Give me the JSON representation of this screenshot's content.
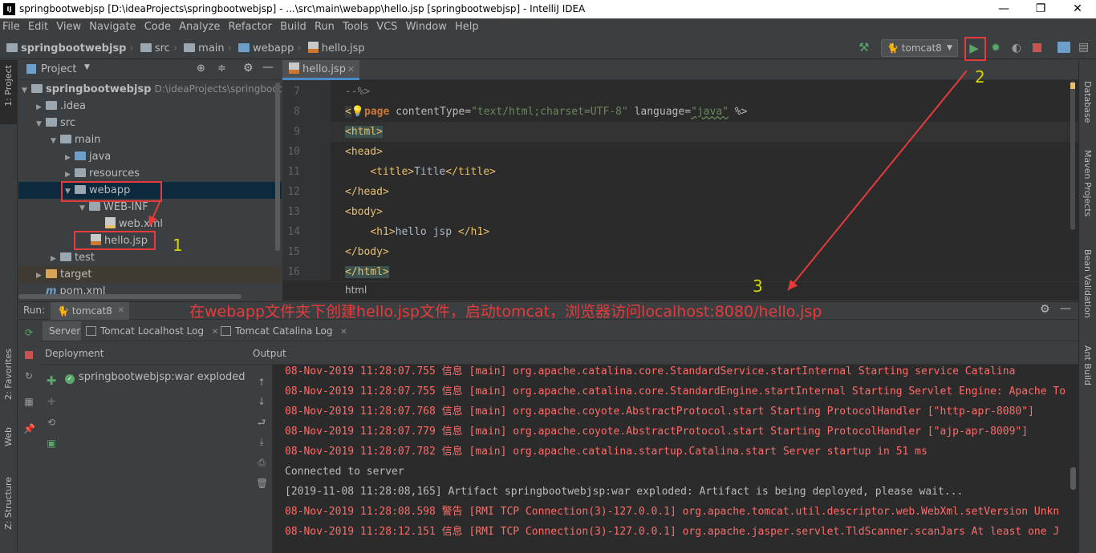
{
  "window": {
    "title": "springbootwebjsp [D:\\ideaProjects\\springbootwebjsp] - ...\\src\\main\\webapp\\hello.jsp [springbootwebjsp] - IntelliJ IDEA",
    "minimize": "—",
    "maximize": "❐",
    "close": "✕"
  },
  "menu": [
    "File",
    "Edit",
    "View",
    "Navigate",
    "Code",
    "Analyze",
    "Refactor",
    "Build",
    "Run",
    "Tools",
    "VCS",
    "Window",
    "Help"
  ],
  "breadcrumb": [
    "springbootwebjsp",
    "src",
    "main",
    "webapp",
    "hello.jsp"
  ],
  "toolbar": {
    "run_config": "tomcat8"
  },
  "left_strip": {
    "project": "1: Project",
    "favorites": "2: Favorites",
    "web": "Web",
    "structure": "Z: Structure"
  },
  "right_strip": {
    "database": "Database",
    "maven": "Maven Projects",
    "bean": "Bean Validation",
    "ant": "Ant Build"
  },
  "project_panel": {
    "header": "Project",
    "tree": [
      {
        "label": "springbootwebjsp",
        "hint": "D:\\ideaProjects\\springbootwe"
      },
      {
        "label": ".idea"
      },
      {
        "label": "src"
      },
      {
        "label": "main"
      },
      {
        "label": "java"
      },
      {
        "label": "resources"
      },
      {
        "label": "webapp"
      },
      {
        "label": "WEB-INF"
      },
      {
        "label": "web.xml"
      },
      {
        "label": "hello.jsp"
      },
      {
        "label": "test"
      },
      {
        "label": "target"
      },
      {
        "label": "pom.xml"
      }
    ]
  },
  "editor": {
    "tab": "hello.jsp",
    "breadcrumb": "html",
    "line_numbers": [
      "7",
      "8",
      "9",
      "10",
      "11",
      "12",
      "13",
      "14",
      "15",
      "16"
    ],
    "lines": {
      "l7": "--%>",
      "l8_kw": "page",
      "l8_attr1": " contentType=",
      "l8_val1": "\"text/html;charset=UTF-8\"",
      "l8_attr2": " language=",
      "l8_val2": "\"java\"",
      "l8_end": " %>",
      "l9": "<html>",
      "l10": "<head>",
      "l11_open": "<title>",
      "l11_text": "Title",
      "l11_close": "</title>",
      "l12": "</head>",
      "l13": "<body>",
      "l14_open": "<h1>",
      "l14_text": "hello jsp ",
      "l14_close": "</h1>",
      "l15": "</body>",
      "l16": "</html>"
    }
  },
  "run_panel": {
    "label": "Run:",
    "config_tab": "tomcat8",
    "subtabs": [
      "Server",
      "Tomcat Localhost Log",
      "Tomcat Catalina Log"
    ],
    "deployment_header": "Deployment",
    "output_header": "Output",
    "deployment_item": "springbootwebjsp:war exploded",
    "output_lines": [
      "08-Nov-2019 11:28:07.755 信息 [main] org.apache.catalina.core.StandardService.startInternal Starting service Catalina",
      "08-Nov-2019 11:28:07.755 信息 [main] org.apache.catalina.core.StandardEngine.startInternal Starting Servlet Engine: Apache To",
      "08-Nov-2019 11:28:07.768 信息 [main] org.apache.coyote.AbstractProtocol.start Starting ProtocolHandler [\"http-apr-8080\"]",
      "08-Nov-2019 11:28:07.779 信息 [main] org.apache.coyote.AbstractProtocol.start Starting ProtocolHandler [\"ajp-apr-8009\"]",
      "08-Nov-2019 11:28:07.782 信息 [main] org.apache.catalina.startup.Catalina.start Server startup in 51 ms",
      "Connected to server",
      "[2019-11-08 11:28:08,165] Artifact springbootwebjsp:war exploded: Artifact is being deployed, please wait...",
      "08-Nov-2019 11:28:08.598 警告 [RMI TCP Connection(3)-127.0.0.1] org.apache.tomcat.util.descriptor.web.WebXml.setVersion Unkn",
      "08-Nov-2019 11:28:12.151 信息 [RMI TCP Connection(3)-127.0.0.1] org.apache.jasper.servlet.TldScanner.scanJars At least one J"
    ]
  },
  "annotations": {
    "n1": "1",
    "n2": "2",
    "n3": "3",
    "caption": "在webapp文件夹下创建hello.jsp文件，启动tomcat，浏览器访问localhost:8080/hello.jsp"
  },
  "colors": {
    "accent_red": "#e53b3b",
    "annotation_yellow": "#d4d400",
    "run_green": "#59a869"
  }
}
